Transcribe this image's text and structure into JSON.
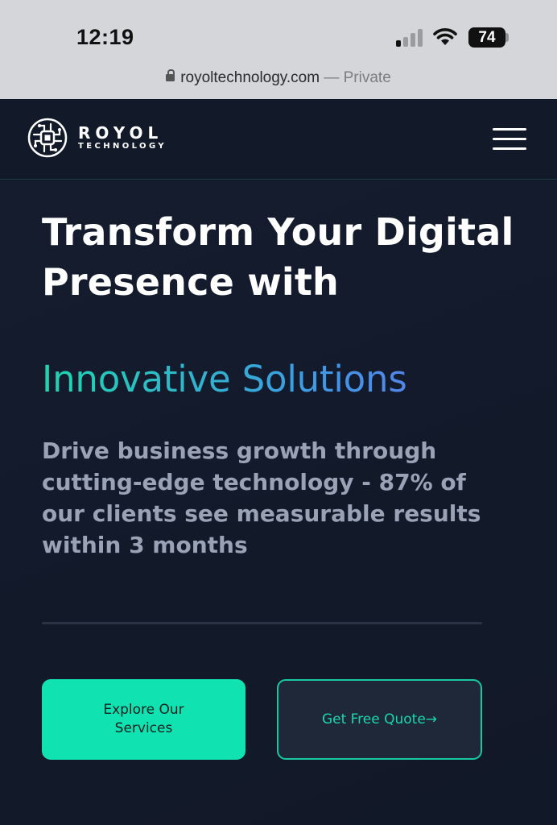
{
  "status_bar": {
    "time": "12:19",
    "battery": "74"
  },
  "browser": {
    "url": "royoltechnology.com",
    "mode": "— Private"
  },
  "header": {
    "logo_name": "ROYOL",
    "logo_sub": "TECHNOLOGY",
    "menu_icon": "hamburger-menu-icon"
  },
  "hero": {
    "headline": "Transform Your Digital Presence with",
    "headline_accent": "Innovative Solutions",
    "subcopy": "Drive business growth through cutting-edge technology - 87% of our clients see measurable results within 3 months",
    "primary_button": "Explore Our Services",
    "secondary_button": "Get Free Quote→"
  },
  "colors": {
    "background": "#111827",
    "accent_teal": "#10e3b1",
    "accent_gradient_end": "#6b6cf0",
    "subcopy": "#9aa3b5"
  }
}
